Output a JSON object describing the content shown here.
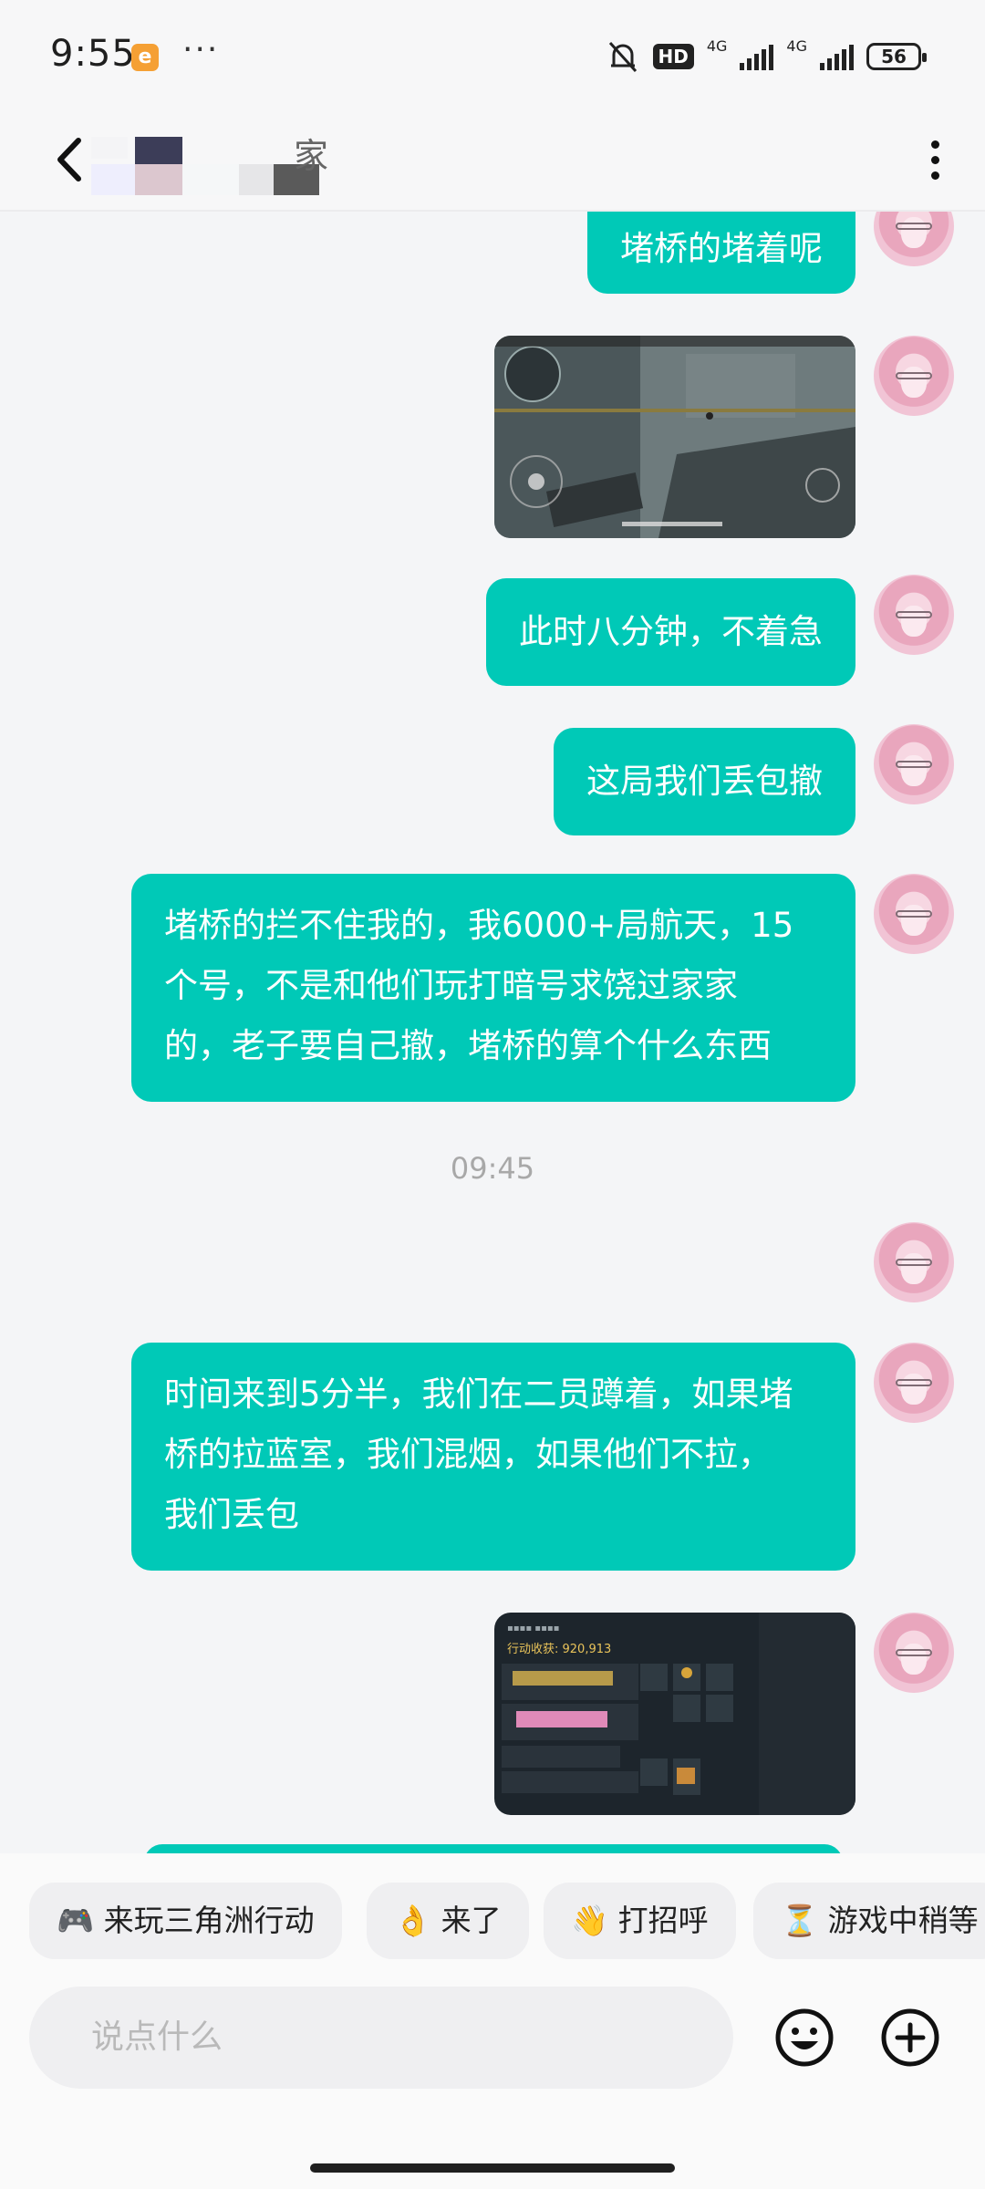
{
  "status": {
    "time": "9:55",
    "app_badge": "e",
    "more_dots": "···",
    "hd": "HD",
    "net1": "4G",
    "net2": "4G",
    "battery": "56"
  },
  "header": {
    "title_visible": "家"
  },
  "messages": [
    {
      "type": "text",
      "text": "堵桥的堵着呢"
    },
    {
      "type": "image",
      "icon": "game-screenshot-hallway"
    },
    {
      "type": "text",
      "text": "此时八分钟，不着急"
    },
    {
      "type": "text",
      "text": "这局我们丢包撤"
    },
    {
      "type": "text",
      "lines": [
        "堵桥的拦不住我的，我6000+局航天，15",
        "个号，不是和他们玩打暗号求饶过家家",
        "的，老子要自己撤，堵桥的算个什么东西"
      ]
    },
    {
      "type": "time",
      "text": "09:45"
    },
    {
      "type": "text",
      "lines": [
        "时间来到5分半，我们在二员蹲着，如果堵",
        "桥的拉蓝室，我们混烟，如果他们不拉，",
        "我们丢包"
      ]
    },
    {
      "type": "image",
      "icon": "game-screenshot-loot",
      "caption": "行动收获: 920,913"
    }
  ],
  "quick_replies": [
    {
      "emoji": "🎮",
      "label": "来玩三角洲行动"
    },
    {
      "emoji": "👌",
      "label": "来了"
    },
    {
      "emoji": "👋",
      "label": "打招呼"
    },
    {
      "emoji": "⏳",
      "label": "游戏中稍等"
    }
  ],
  "composer": {
    "placeholder": "说点什么",
    "emoji_icon": "smiley-icon",
    "plus_icon": "plus-circle-icon"
  },
  "colors": {
    "bubble": "#00c9b7",
    "background": "#f4f5f7"
  }
}
